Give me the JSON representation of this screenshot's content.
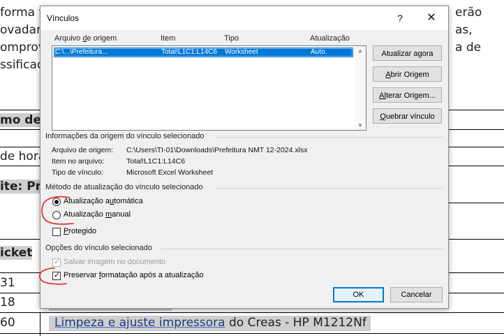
{
  "document": {
    "left_lines": [
      "forma t",
      "ovadan",
      "omprov",
      "ssificac"
    ],
    "right_lines": [
      "erão",
      "as,",
      "a de"
    ],
    "row_texts": [
      "mo de",
      "de hora",
      "ite: Pre",
      "icket",
      "31",
      "18",
      "60"
    ],
    "bottom_link": "Limpeza e ajuste impressora",
    "bottom_rest": " do Creas - HP M1212Nf"
  },
  "dialog": {
    "title": "Vínculos",
    "help_symbol": "?",
    "close_symbol": "✕",
    "columns": {
      "source_pre": "Arquivo ",
      "source_u": "d",
      "source_post": "e origem",
      "item": "Item",
      "type": "Tipo",
      "update": "Atualização"
    },
    "links": [
      {
        "source": "C:\\...\\Prefeitura...",
        "item": "Total!L1C1:L14C6",
        "type": "Worksheet",
        "update": "Auto."
      }
    ],
    "buttons": {
      "update_now": "Atualizar agora",
      "open_source_u": "A",
      "open_source_rest": "brir Origem",
      "change_source_pre": "A",
      "change_source_u": "l",
      "change_source_rest": "terar Origem...",
      "break_link_u": "Q",
      "break_link_rest": "uebrar vínculo",
      "ok": "OK",
      "cancel": "Cancelar"
    },
    "source_info": {
      "group_title": "Informações da origem do vínculo selecionado",
      "file_label": "Arquivo de origem:",
      "file_value": "C:\\Users\\TI-01\\Downloads\\Prefeitura NMT 12-2024.xlsx",
      "item_label": "Item no arquivo:",
      "item_value": "Total!L1C1:L14C6",
      "type_label": "Tipo de vínculo:",
      "type_value": "Microsoft Excel Worksheet"
    },
    "update_method": {
      "group_title": "Método de atualização do vínculo selecionado",
      "auto_pre": "Atualização a",
      "auto_u": "u",
      "auto_post": "tomática",
      "manual_pre": "Atualização ",
      "manual_u": "m",
      "manual_post": "anual",
      "protected_u": "P",
      "protected_post": "rotegido",
      "selected": "auto"
    },
    "options": {
      "group_title": "Opções do vínculo selecionado",
      "save_image": "Salvar imagem no documento",
      "save_image_checked": true,
      "save_image_enabled": false,
      "preserve_pre": "Preservar ",
      "preserve_u": "f",
      "preserve_post": "ormatação após a atualização",
      "preserve_checked": true
    }
  },
  "colors": {
    "selection": "#0078d7",
    "annotation": "#e0211b",
    "dialog_bg": "#f0f0f0"
  }
}
